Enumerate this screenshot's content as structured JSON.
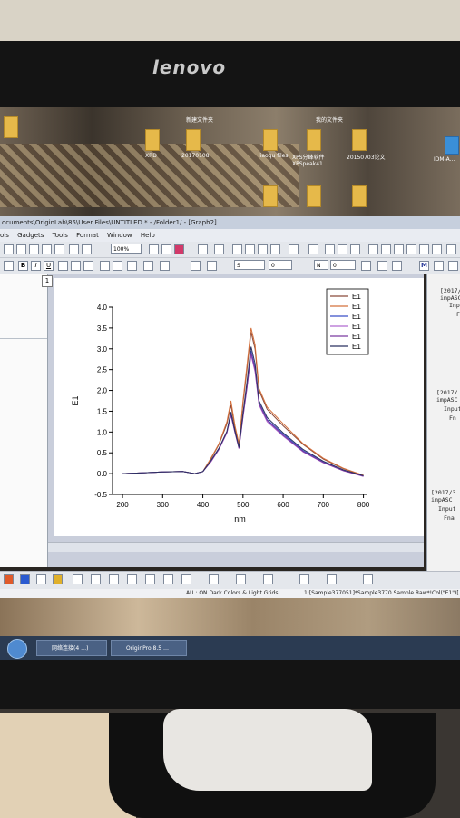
{
  "monitor": {
    "brand": "lenovo"
  },
  "desktop": {
    "icons": [
      {
        "label": "XRD"
      },
      {
        "label": "20170108"
      },
      {
        "label": "liaoqu files"
      },
      {
        "label": "XPS分峰软件 XPSpeak41"
      },
      {
        "label": "20150703论文"
      },
      {
        "label": "新建文件夹"
      },
      {
        "label": "我的文件夹"
      },
      {
        "label": "IDM-A..."
      }
    ]
  },
  "window": {
    "title": "ocuments\\OriginLab\\85\\User Files\\UNTITLED * - /Folder1/ - [Graph2]",
    "menu": [
      "ols",
      "Gadgets",
      "Tools",
      "Format",
      "Window",
      "Help"
    ],
    "zoom": "100%",
    "font_size_field": "0",
    "line_style_field": "S",
    "line_width_field": "0",
    "fill_field": "N",
    "layer_tab": "1"
  },
  "right_panel": {
    "lines": [
      "[2017/",
      "impASC",
      "Input",
      "F",
      "[2017/",
      "impASC",
      "Input",
      "Fn",
      "[2017/3",
      "impASC",
      "Input",
      "Fna"
    ]
  },
  "status": {
    "au": "AU : ON  Dark Colors & Light Grids",
    "sheet": "1:[Sample377051]*Sample3770.Sample.Raw*!Col(\"E1\")["
  },
  "taskbar": {
    "items": [
      "网络连接(4 …)",
      "OriginPro 8.5 …"
    ]
  },
  "chart_data": {
    "type": "line",
    "xlabel": "nm",
    "ylabel": "E1",
    "xlim": [
      175,
      810
    ],
    "ylim": [
      -0.5,
      4.0
    ],
    "xticks": [
      200,
      300,
      400,
      500,
      600,
      700,
      800
    ],
    "yticks": [
      -0.5,
      0.0,
      0.5,
      1.0,
      1.5,
      2.0,
      2.5,
      3.0,
      3.5,
      4.0
    ],
    "legend_position": "top-right",
    "x": [
      200,
      250,
      300,
      350,
      380,
      400,
      420,
      440,
      460,
      470,
      480,
      490,
      500,
      510,
      520,
      530,
      540,
      560,
      600,
      650,
      700,
      750,
      800
    ],
    "series": [
      {
        "name": "E1",
        "color": "#8b4a3a",
        "values": [
          0.0,
          0.02,
          0.04,
          0.05,
          0.0,
          0.05,
          0.35,
          0.7,
          1.2,
          1.65,
          1.1,
          0.7,
          1.7,
          2.5,
          3.4,
          3.0,
          2.0,
          1.55,
          1.15,
          0.7,
          0.35,
          0.12,
          -0.05
        ]
      },
      {
        "name": "E1",
        "color": "#d4703c",
        "values": [
          0.0,
          0.02,
          0.04,
          0.05,
          0.0,
          0.05,
          0.37,
          0.72,
          1.25,
          1.75,
          1.15,
          0.72,
          1.75,
          2.6,
          3.5,
          3.1,
          2.05,
          1.6,
          1.2,
          0.72,
          0.37,
          0.13,
          -0.04
        ]
      },
      {
        "name": "E1",
        "color": "#3a4fc8",
        "values": [
          0.0,
          0.02,
          0.04,
          0.05,
          0.0,
          0.05,
          0.3,
          0.6,
          1.0,
          1.45,
          1.0,
          0.62,
          1.4,
          2.1,
          2.95,
          2.55,
          1.7,
          1.3,
          0.95,
          0.55,
          0.28,
          0.08,
          -0.06
        ]
      },
      {
        "name": "E1",
        "color": "#b06ad0",
        "values": [
          0.0,
          0.02,
          0.04,
          0.05,
          0.0,
          0.05,
          0.28,
          0.58,
          0.98,
          1.4,
          0.98,
          0.6,
          1.35,
          2.05,
          2.85,
          2.45,
          1.65,
          1.25,
          0.9,
          0.52,
          0.26,
          0.07,
          -0.07
        ]
      },
      {
        "name": "E1",
        "color": "#7a3aa0",
        "values": [
          0.0,
          0.02,
          0.04,
          0.05,
          0.0,
          0.05,
          0.29,
          0.59,
          0.99,
          1.42,
          0.99,
          0.61,
          1.37,
          2.08,
          2.9,
          2.5,
          1.68,
          1.28,
          0.92,
          0.53,
          0.27,
          0.07,
          -0.06
        ]
      },
      {
        "name": "E1",
        "color": "#2a3060",
        "values": [
          0.0,
          0.02,
          0.04,
          0.05,
          0.0,
          0.05,
          0.31,
          0.61,
          1.02,
          1.48,
          1.02,
          0.63,
          1.45,
          2.2,
          3.05,
          2.65,
          1.75,
          1.35,
          0.98,
          0.58,
          0.3,
          0.09,
          -0.05
        ]
      }
    ]
  }
}
